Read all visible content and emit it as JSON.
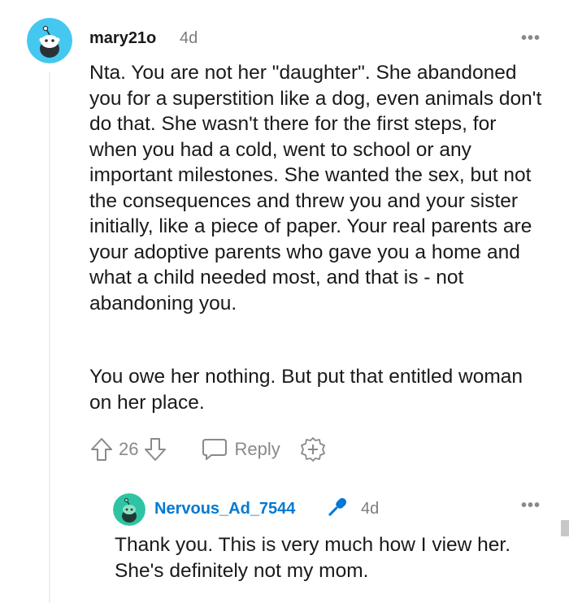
{
  "comment": {
    "author": "mary21o",
    "age": "4d",
    "more_label": "•••",
    "paragraphs": [
      "Nta. You are not her \"daughter\". She abandoned you for a superstition like a dog, even animals don't do that. She wasn't there for the first steps, for when you had a cold, went to school or any important milestones. She wanted the sex, but not the consequences and threw you and your sister initially, like a piece of paper. Your real parents are your adoptive parents who gave you a home and what a child needed most, and that is - not abandoning you.",
      "You owe her nothing. But put that entitled woman on her place."
    ],
    "score": "26",
    "reply_label": "Reply",
    "avatar_color": "#45c8f0"
  },
  "reply": {
    "author": "Nervous_Ad_7544",
    "age": "4d",
    "more_label": "•••",
    "text": "Thank you. This is very much how I view her. She's definitely not my mom.",
    "author_color": "#0079d3",
    "avatar_color": "#2ec4a3",
    "flair_icon": "microphone-icon"
  }
}
